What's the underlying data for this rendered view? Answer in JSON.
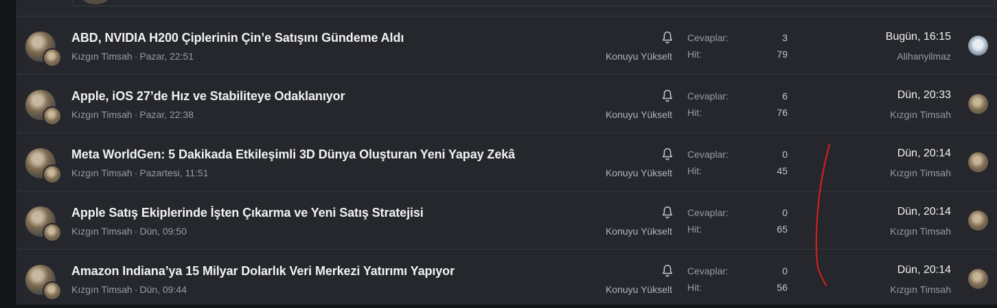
{
  "threads": [
    {
      "title": "ABD, NVIDIA H200 Çiplerinin Çin’e Satışını Gündeme Aldı",
      "author": "Kızgın Timsah",
      "started": "Pazar, 22:51",
      "promote": "Konuyu Yükselt",
      "replies_label": "Cevaplar:",
      "replies": "3",
      "hits_label": "Hit:",
      "hits": "79",
      "last_date": "Bugün, 16:15",
      "last_user": "Alihanyilmaz"
    },
    {
      "title": "Apple, iOS 27’de Hız ve Stabiliteye Odaklanıyor",
      "author": "Kızgın Timsah",
      "started": "Pazar, 22:38",
      "promote": "Konuyu Yükselt",
      "replies_label": "Cevaplar:",
      "replies": "6",
      "hits_label": "Hit:",
      "hits": "76",
      "last_date": "Dün, 20:33",
      "last_user": "Kızgın Timsah"
    },
    {
      "title": "Meta WorldGen: 5 Dakikada Etkileşimli 3D Dünya Oluşturan Yeni Yapay Zekâ",
      "author": "Kızgın Timsah",
      "started": "Pazartesi, 11:51",
      "promote": "Konuyu Yükselt",
      "replies_label": "Cevaplar:",
      "replies": "0",
      "hits_label": "Hit:",
      "hits": "45",
      "last_date": "Dün, 20:14",
      "last_user": "Kızgın Timsah"
    },
    {
      "title": "Apple Satış Ekiplerinde İşten Çıkarma ve Yeni Satış Stratejisi",
      "author": "Kızgın Timsah",
      "started": "Dün, 09:50",
      "promote": "Konuyu Yükselt",
      "replies_label": "Cevaplar:",
      "replies": "0",
      "hits_label": "Hit:",
      "hits": "65",
      "last_date": "Dün, 20:14",
      "last_user": "Kızgın Timsah"
    },
    {
      "title": "Amazon Indiana’ya 15 Milyar Dolarlık Veri Merkezi Yatırımı Yapıyor",
      "author": "Kızgın Timsah",
      "started": "Dün, 09:44",
      "promote": "Konuyu Yükselt",
      "replies_label": "Cevaplar:",
      "replies": "0",
      "hits_label": "Hit:",
      "hits": "56",
      "last_date": "Dün, 20:14",
      "last_user": "Kızgın Timsah"
    }
  ],
  "icons": {
    "watch": "bell-icon",
    "sep": "·"
  },
  "colors": {
    "background": "#25272d",
    "title": "#f2f3f5",
    "muted": "#9a9ca3",
    "annotation": "#e0201c"
  }
}
